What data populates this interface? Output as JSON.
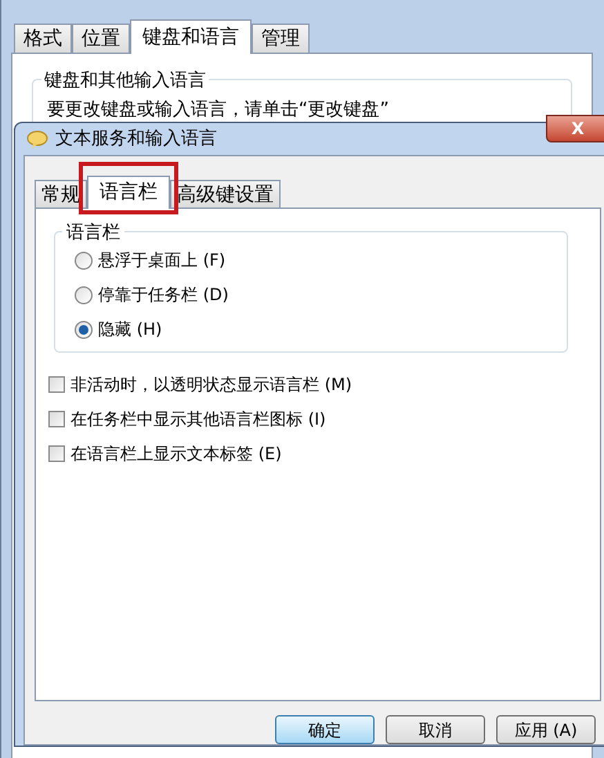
{
  "back_window": {
    "tabs": [
      {
        "label": "格式",
        "selected": false
      },
      {
        "label": "位置",
        "selected": false
      },
      {
        "label": "键盘和语言",
        "selected": true
      },
      {
        "label": "管理",
        "selected": false
      }
    ],
    "group_title": "键盘和其他输入语言",
    "text": "要更改键盘或输入语言，请单击“更改键盘”"
  },
  "dialog": {
    "title": "文本服务和输入语言",
    "close": "X",
    "tabs": [
      {
        "label": "常规",
        "selected": false,
        "highlighted": false
      },
      {
        "label": "语言栏",
        "selected": true,
        "highlighted": true
      },
      {
        "label": "高级键设置",
        "selected": false,
        "highlighted": false
      }
    ],
    "group_title": "语言栏",
    "radios": [
      {
        "label": "悬浮于桌面上 (F)",
        "selected": false
      },
      {
        "label": "停靠于任务栏 (D)",
        "selected": false
      },
      {
        "label": "隐藏 (H)",
        "selected": true
      }
    ],
    "checkboxes": [
      {
        "label": "非活动时，以透明状态显示语言栏 (M)",
        "checked": false
      },
      {
        "label": "在任务栏中显示其他语言栏图标 (I)",
        "checked": false
      },
      {
        "label": "在语言栏上显示文本标签 (E)",
        "checked": false
      }
    ],
    "buttons": [
      {
        "label": "确定",
        "default": true
      },
      {
        "label": "取消",
        "default": false
      },
      {
        "label": "应用 (A)",
        "default": false
      }
    ]
  }
}
